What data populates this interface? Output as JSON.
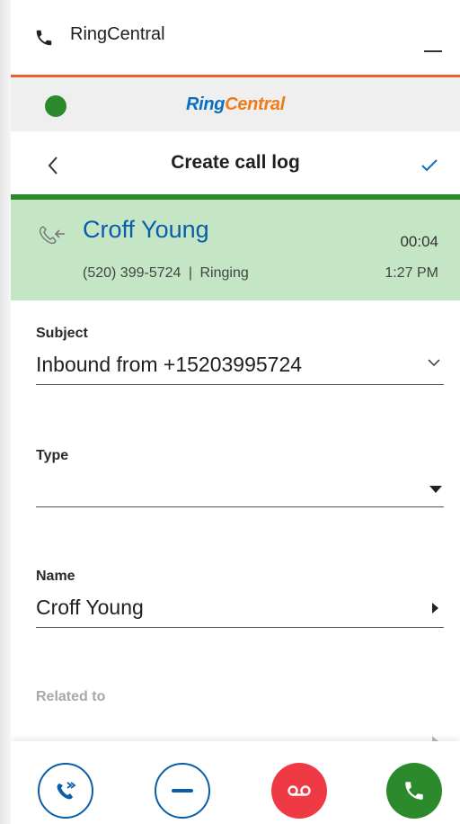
{
  "window": {
    "app_name": "RingCentral"
  },
  "brand": {
    "ring": "Ring",
    "central": "Central",
    "presence_color": "#2c8a2c"
  },
  "header": {
    "title": "Create call log"
  },
  "call": {
    "contact_name": "Croff Young",
    "phone": "(520) 399-5724",
    "separator": "|",
    "status": "Ringing",
    "duration": "00:04",
    "time": "1:27 PM",
    "direction_icon": "inbound-call-icon"
  },
  "form": {
    "subject": {
      "label": "Subject",
      "value": "Inbound from +15203995724"
    },
    "type": {
      "label": "Type",
      "value": ""
    },
    "name": {
      "label": "Name",
      "value": "Croff Young"
    },
    "related_to": {
      "label": "Related to",
      "value": ""
    }
  },
  "actions": [
    {
      "name": "forward",
      "icon": "forward-call-icon"
    },
    {
      "name": "ignore",
      "icon": "minus-icon"
    },
    {
      "name": "voicemail",
      "icon": "voicemail-icon"
    },
    {
      "name": "answer",
      "icon": "phone-icon"
    }
  ],
  "colors": {
    "accent_orange": "#e8612c",
    "active_green": "#2c8a2c",
    "call_bg": "#c5e6c5",
    "link_blue": "#0a5ea8",
    "voicemail_red": "#ef3a46"
  }
}
